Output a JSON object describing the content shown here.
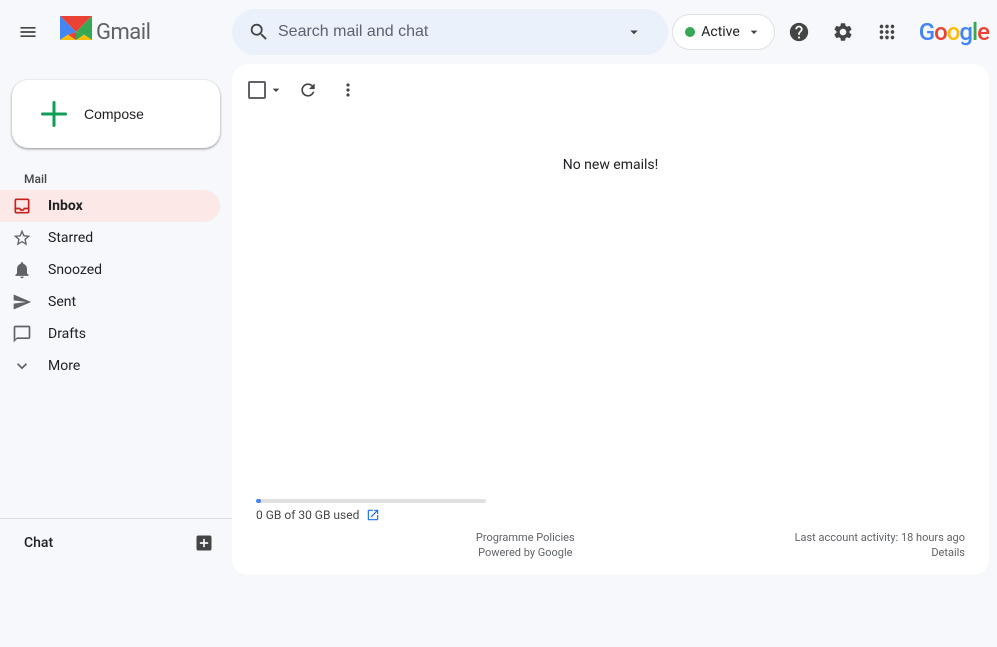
{
  "header": {
    "menu_label": "Main menu",
    "logo_text": "Gmail",
    "search_placeholder": "Search mail and chat",
    "active_label": "Active",
    "help_label": "Help",
    "settings_label": "Settings",
    "apps_label": "Google apps",
    "google_label": "Google"
  },
  "compose": {
    "button_label": "Compose"
  },
  "sidebar": {
    "mail_section": "Mail",
    "items": [
      {
        "id": "inbox",
        "label": "Inbox",
        "active": true
      },
      {
        "id": "starred",
        "label": "Starred"
      },
      {
        "id": "snoozed",
        "label": "Snoozed"
      },
      {
        "id": "sent",
        "label": "Sent"
      },
      {
        "id": "drafts",
        "label": "Drafts"
      },
      {
        "id": "more",
        "label": "More"
      }
    ],
    "chat_section": "Chat"
  },
  "toolbar": {
    "refresh_label": "Refresh",
    "more_label": "More"
  },
  "main": {
    "empty_message": "No new emails!"
  },
  "footer": {
    "storage_used": "0 GB of 30 GB used",
    "storage_percent": 2,
    "programme_policies": "Programme Policies",
    "powered_by": "Powered by Google",
    "last_activity": "Last account activity: 18 hours ago",
    "details": "Details"
  }
}
